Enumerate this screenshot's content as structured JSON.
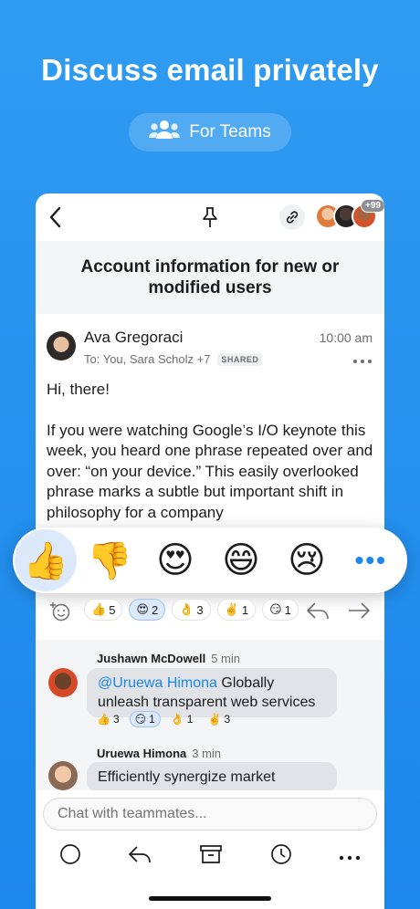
{
  "hero": {
    "title": "Discuss email privately",
    "pill_label": "For Teams"
  },
  "topbar": {
    "participants_badge": "+99"
  },
  "email": {
    "subject": "Account information for new or modified users",
    "sender": "Ava Gregoraci",
    "to": "To: You, Sara Scholz +7",
    "shared_tag": "SHARED",
    "time": "10:00 am",
    "greeting": "Hi, there!",
    "body": "If you were watching Google’s I/O keynote this week, you heard one phrase repeated over and over: “on your device.” This easily overlooked phrase marks a subtle but important shift in philosophy for a company"
  },
  "reaction_picker": {
    "items": [
      "👍",
      "👎",
      "😍",
      "😄",
      "😢"
    ],
    "more": "•••"
  },
  "reactions": [
    {
      "emoji": "👍",
      "count": "5"
    },
    {
      "emoji": "😍",
      "count": "2"
    },
    {
      "emoji": "👌",
      "count": "3"
    },
    {
      "emoji": "✌️",
      "count": "1"
    },
    {
      "emoji": "😏",
      "count": "1"
    }
  ],
  "comments": [
    {
      "author": "Jushawn McDowell",
      "time": "5 min",
      "mention": "@Uruewa Himona",
      "text": " Globally unleash transparent web services",
      "reactions": [
        {
          "emoji": "👍",
          "count": "3"
        },
        {
          "emoji": "😏",
          "count": "1"
        },
        {
          "emoji": "👌",
          "count": "1"
        },
        {
          "emoji": "✌️",
          "count": "3"
        }
      ]
    },
    {
      "author": "Uruewa Himona",
      "time": "3 min",
      "text": "Efficiently synergize market"
    }
  ],
  "composer": {
    "placeholder": "Chat with teammates..."
  }
}
